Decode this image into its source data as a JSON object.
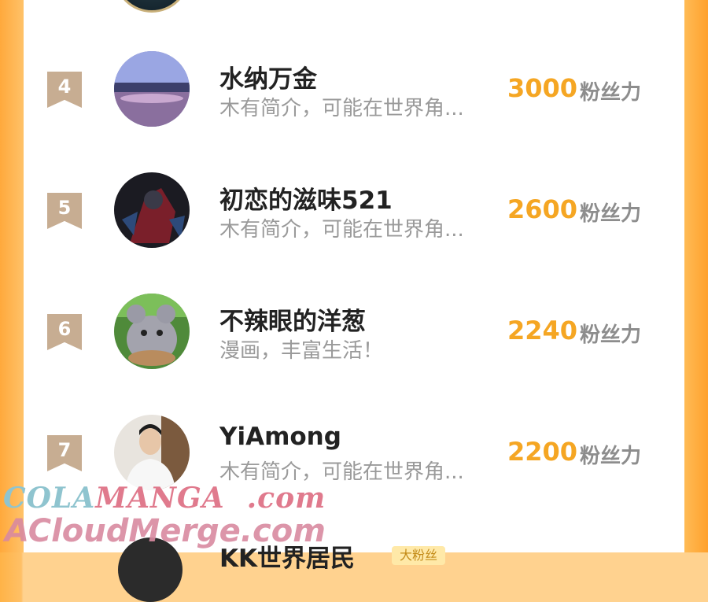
{
  "ranking": [
    {
      "rank": "4",
      "name": "水纳万金",
      "intro": "木有简介，可能在世界角...",
      "score": "3000",
      "unit": "粉丝力"
    },
    {
      "rank": "5",
      "name": "初恋的滋味521",
      "intro": "木有简介，可能在世界角...",
      "score": "2600",
      "unit": "粉丝力"
    },
    {
      "rank": "6",
      "name": "不辣眼的洋葱",
      "intro": "漫画，丰富生活！",
      "score": "2240",
      "unit": "粉丝力"
    },
    {
      "rank": "7",
      "name": "YiAmong",
      "intro": "木有简介，可能在世界角...",
      "score": "2200",
      "unit": "粉丝力"
    }
  ],
  "next_entry": {
    "name": "KK世界居民",
    "badge": "大粉丝"
  },
  "watermark": {
    "line1_a": "COLA",
    "line1_b": "MANGA",
    "line1_c": ".com",
    "line2": "ACloudMerge.com"
  },
  "colors": {
    "score": "#f5a623",
    "rank_badge": "#c7ad92",
    "side": "#ffa93c"
  }
}
